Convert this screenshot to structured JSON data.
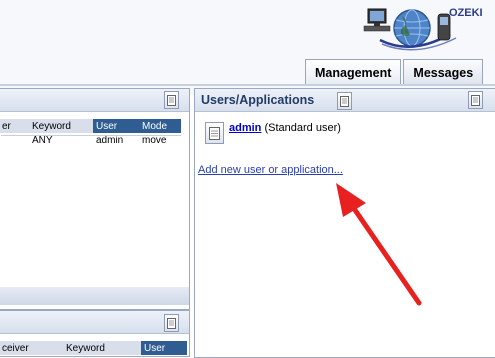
{
  "brand": {
    "logo_text": "OZEKI"
  },
  "tabs": [
    {
      "label": "Management"
    },
    {
      "label": "Messages"
    }
  ],
  "left_panel_top": {
    "columns": [
      "er",
      "Keyword",
      "User",
      "Mode"
    ],
    "rows": [
      [
        "",
        "ANY",
        "admin",
        "move"
      ]
    ]
  },
  "left_panel_bottom": {
    "columns": [
      "ceiver",
      "Keyword",
      "User"
    ]
  },
  "users_panel": {
    "title": "Users/Applications",
    "user_name": "admin",
    "user_type": "(Standard user)",
    "add_link": "Add new user or application..."
  },
  "colors": {
    "header_selected": "#2f5d92",
    "panel_title": "#223c68",
    "link": "#2a3fb0",
    "arrow": "#e8201f"
  }
}
